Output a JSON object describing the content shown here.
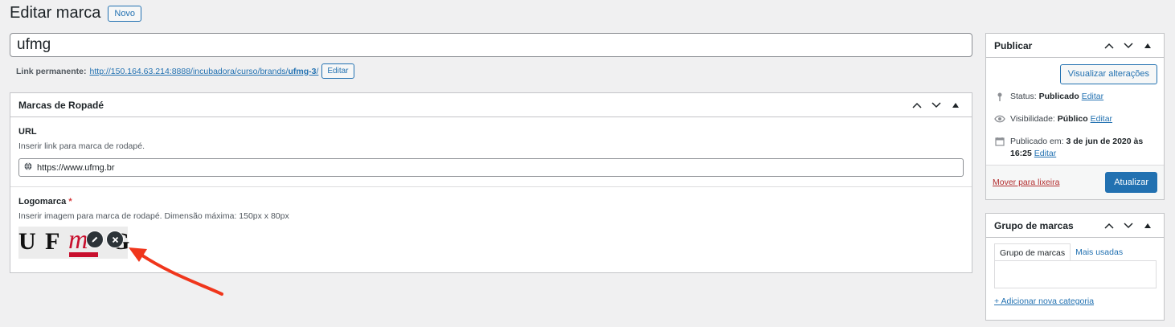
{
  "header": {
    "title": "Editar marca",
    "new_button": "Novo"
  },
  "post_title": {
    "value": "ufmg"
  },
  "permalink": {
    "label": "Link permanente:",
    "url_prefix": "http://150.164.63.214:8888/incubadora/curso/brands/",
    "url_slug": "ufmg-3",
    "url_suffix": "/",
    "edit_button": "Editar"
  },
  "footer_brands_box": {
    "title": "Marcas de Ropadé",
    "url_field": {
      "label": "URL",
      "description": "Inserir link para marca de rodapé.",
      "value": "https://www.ufmg.br",
      "icon": "globe-icon"
    },
    "logo_field": {
      "label": "Logomarca",
      "required_mark": "*",
      "description": "Inserir imagem para marca de rodapé. Dimensão máxima: 150px x 80px",
      "logo_text_left": "U F",
      "logo_text_mid": "m",
      "logo_text_right": "G",
      "edit_icon": "pencil-icon",
      "remove_icon": "close-icon"
    }
  },
  "publish_box": {
    "title": "Publicar",
    "preview_button": "Visualizar alterações",
    "status_label": "Status:",
    "status_value": "Publicado",
    "status_edit": "Editar",
    "visibility_label": "Visibilidade:",
    "visibility_value": "Público",
    "visibility_edit": "Editar",
    "published_label": "Publicado em:",
    "published_value_line1": "3 de jun de 2020 às",
    "published_value_line2": "16:25",
    "published_edit": "Editar",
    "trash_link": "Mover para lixeira",
    "update_button": "Atualizar"
  },
  "brand_group_box": {
    "title": "Grupo de marcas",
    "tab_all": "Grupo de marcas",
    "tab_popular": "Mais usadas",
    "add_link": "+ Adicionar nova categoria"
  },
  "colors": {
    "accent": "#2271b1",
    "danger": "#b32d2e",
    "annotation_arrow": "#f0361c"
  }
}
